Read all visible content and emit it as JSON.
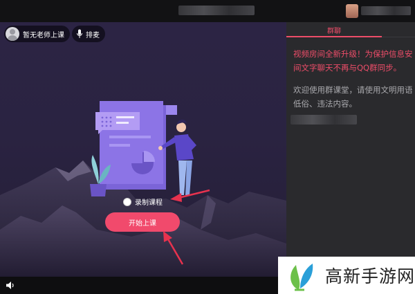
{
  "topbar": {
    "title_blurred": true,
    "user_blurred": true
  },
  "classroom": {
    "teacher_status": "暂无老师上课",
    "queue_button": "排麦",
    "record_option": "录制课程",
    "record_checked": false,
    "start_button": "开始上课"
  },
  "chat": {
    "tab_label": "群聊",
    "notice_lines": "视频房间全新升级！为保护信息安\n间文字聊天不再与QQ群同步。",
    "welcome_lines": "欢迎使用群课堂，请使用文明用语\n低俗、违法内容。"
  },
  "watermark": {
    "text": "高新手游网"
  },
  "colors": {
    "accent": "#f14a6c",
    "chat_red": "#ee4d69",
    "stage_bg": "#2a2341",
    "chat_bg": "#2a2a2d",
    "illustration_purple": "#7b64d8",
    "annotation_arrow": "#e8324e"
  },
  "icons": {
    "teacher_avatar": "user-avatar-icon",
    "queue": "microphone-icon",
    "volume": "speaker-icon",
    "watermark": "leaf-logo-icon"
  }
}
